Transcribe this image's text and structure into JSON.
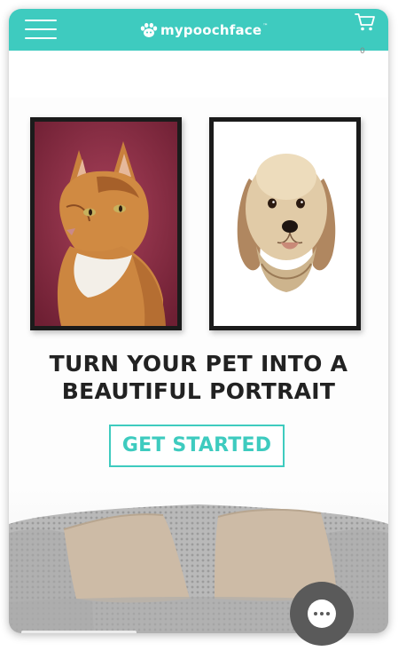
{
  "header": {
    "brand_name": "mypoochface",
    "trademark": "™",
    "cart_count": "0",
    "icons": [
      "menu-icon",
      "paw-logo-icon",
      "cart-icon"
    ]
  },
  "hero": {
    "portraits": [
      {
        "subject": "cat-portrait",
        "background": "#8e2a43"
      },
      {
        "subject": "dog-portrait",
        "background": "#ffffff"
      }
    ],
    "headline_line1": "TURN YOUR PET INTO A",
    "headline_line2": "BEAUTIFUL PORTRAIT",
    "cta_label": "GET STARTED"
  },
  "chat": {
    "icon": "chat-bubble-icon"
  },
  "colors": {
    "brand_teal": "#3ecbbf",
    "headline_text": "#222222",
    "chat_button": "#5a5a5a"
  }
}
